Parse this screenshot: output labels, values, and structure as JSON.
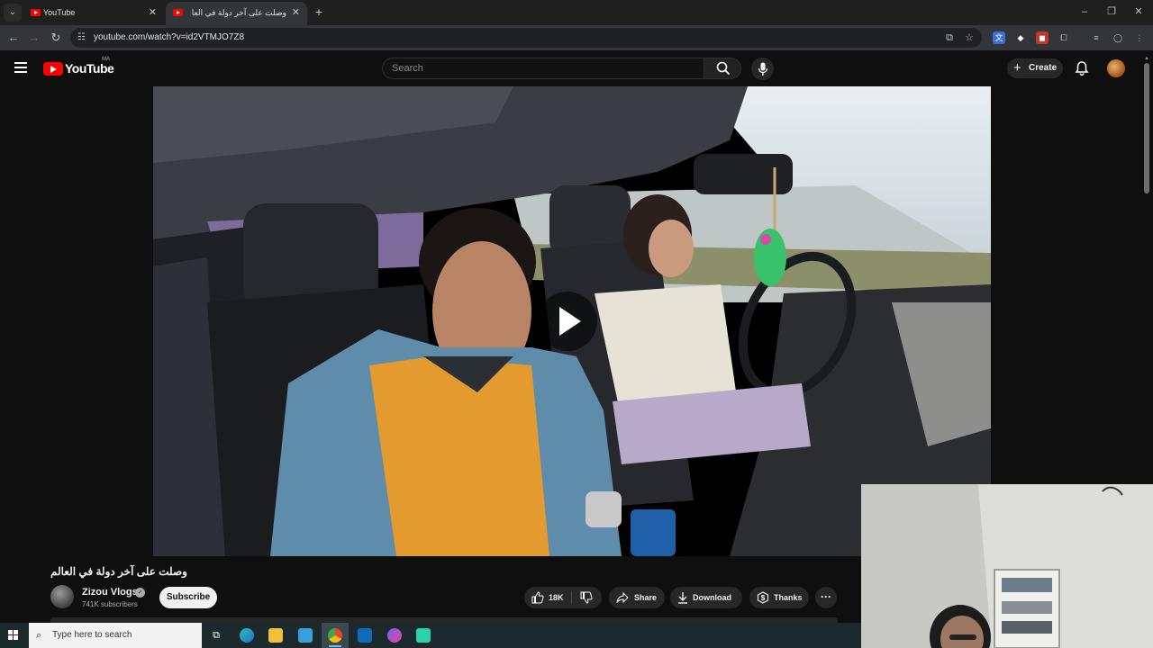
{
  "browser": {
    "tabs": [
      {
        "title": "YouTube",
        "close": "✕"
      },
      {
        "title": "وصلت على آخر دولة في العا",
        "close": "✕"
      }
    ],
    "new_tab": "+",
    "window_controls": {
      "minimize": "–",
      "restore": "❐",
      "close": "✕"
    },
    "url": "youtube.com/watch?v=id2VTMJO7Z8"
  },
  "youtube": {
    "logo_text": "YouTube",
    "region": "MA",
    "search_placeholder": "Search",
    "create_label": "Create"
  },
  "video": {
    "title": "وصلت على آخر دولة في العالم",
    "channel": "Zizou Vlogs",
    "subscribers": "741K subscribers",
    "subscribe_label": "Subscribe",
    "likes": "18K",
    "share_label": "Share",
    "download_label": "Download",
    "thanks_label": "Thanks"
  },
  "taskbar": {
    "search_placeholder": "Type here to search"
  },
  "colors": {
    "youtube_red": "#ff0000",
    "background": "#0f0f0f",
    "pill": "#272727"
  }
}
